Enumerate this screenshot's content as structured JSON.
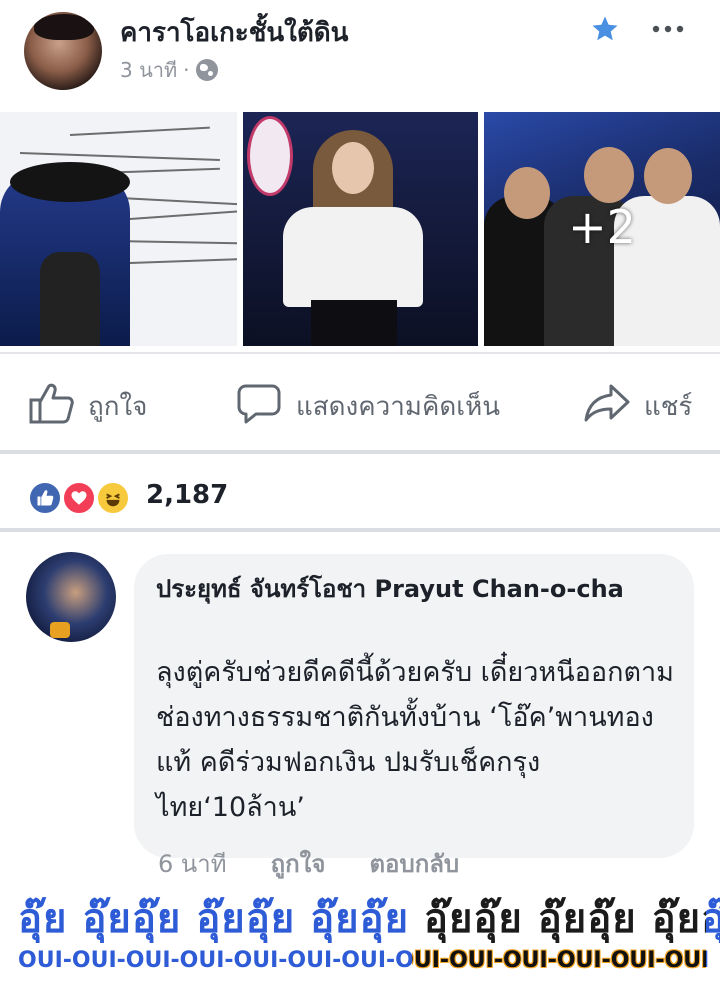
{
  "post": {
    "page_name": "คาราโอเกะชั้นใต้ดิน",
    "time": "3 นาที",
    "separator": "·",
    "photos_more_count": "+2"
  },
  "actions": {
    "like": "ถูกใจ",
    "comment": "แสดงความคิดเห็น",
    "share": "แชร์"
  },
  "reactions": {
    "count": "2,187",
    "types": [
      "like",
      "love",
      "haha"
    ]
  },
  "comment": {
    "author": "ประยุทธ์ จันทร์โอชา Prayut Chan-o-cha",
    "text": "ลุงตู่ครับช่วยดีคดีนี้ด้วยครับ เดี๋ยวหนีออกตามช่องทางธรรมชาติกันทั้งบ้าน ‘โอ๊ค’พานทองแท้ คดีร่วมฟอกเงิน ปมรับเช็คกรุงไทย‘10ล้าน’",
    "time": "6 นาที",
    "like_label": "ถูกใจ",
    "reply_label": "ตอบกลับ"
  },
  "caption": {
    "thai": "อุ๊ย อุ๊ยอุ๊ย อุ๊ยอุ๊ย อุ๊ยอุ๊ย อุ๊ยอุ๊ย อุ๊ยอุ๊ย อุ๊ยอุ๊ย",
    "latin": "OUI-OUI-OUI-OUI-OUI-OUI-OUI-OUI-OUI-OUI-OUI-OUI-OUI"
  },
  "colors": {
    "accent": "#4a90e2",
    "like_blue": "#4267b2",
    "love_red": "#f33e58",
    "haha_yellow": "#f7c93c",
    "caption_blue": "#2e5bd6",
    "caption_highlight": "#f5a623"
  },
  "icons": {
    "star": "star-icon",
    "more": "more-icon",
    "globe": "globe-icon",
    "like": "thumbs-up-icon",
    "comment": "speech-bubble-icon",
    "share": "share-arrow-icon"
  }
}
